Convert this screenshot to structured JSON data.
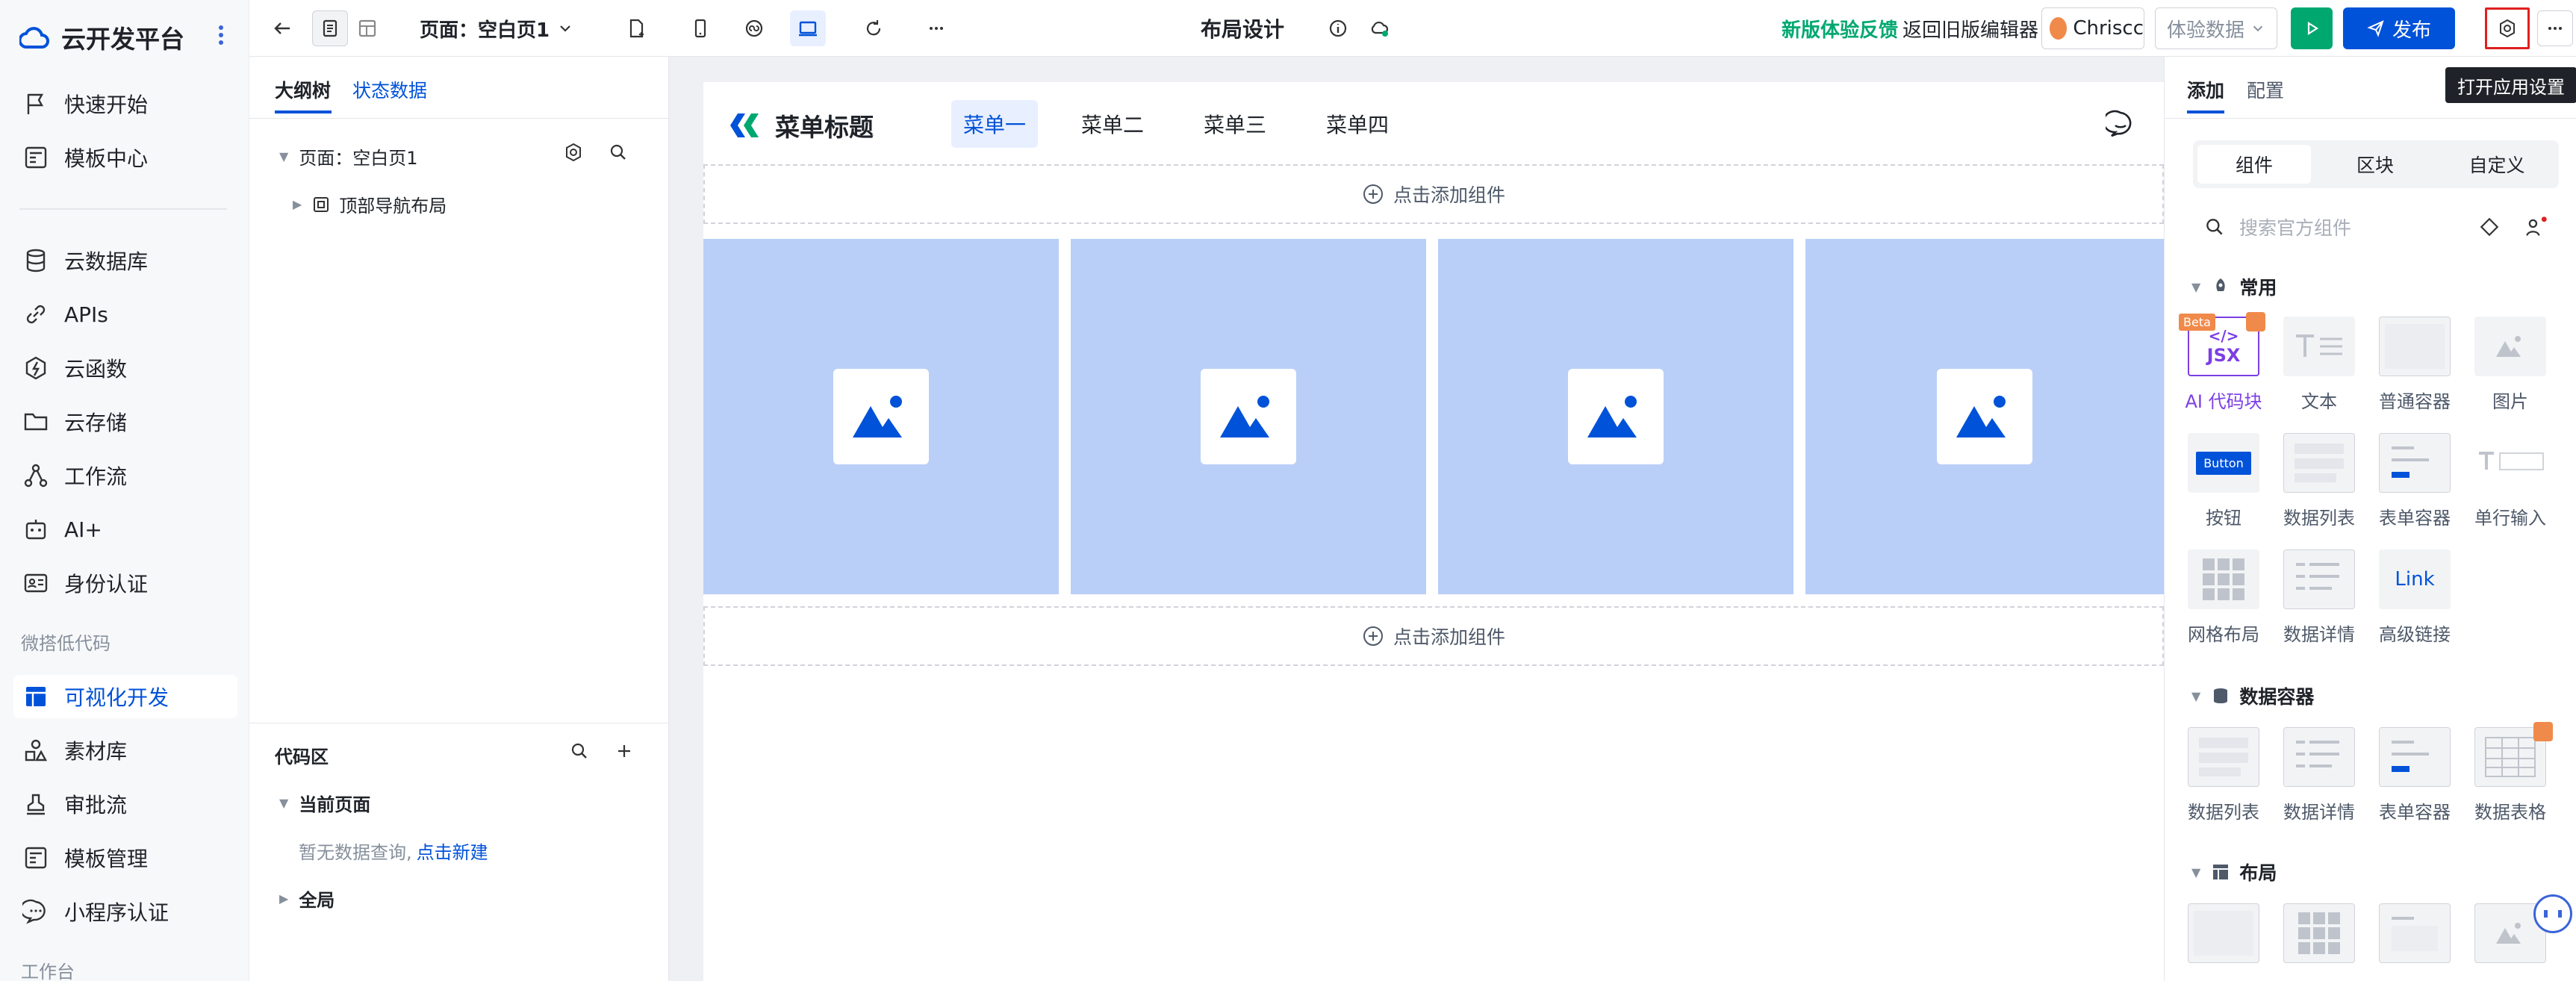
{
  "brand": {
    "name": "云开发平台"
  },
  "nav": {
    "items": [
      {
        "label": "快速开始",
        "icon": "flag-icon"
      },
      {
        "label": "模板中心",
        "icon": "template-icon"
      },
      {
        "label": "云数据库",
        "icon": "database-icon"
      },
      {
        "label": "APIs",
        "icon": "link-icon"
      },
      {
        "label": "云函数",
        "icon": "function-icon"
      },
      {
        "label": "云存储",
        "icon": "folder-icon"
      },
      {
        "label": "工作流",
        "icon": "workflow-icon"
      },
      {
        "label": "AI+",
        "icon": "robot-icon"
      },
      {
        "label": "身份认证",
        "icon": "id-card-icon"
      }
    ],
    "group_lowcode": "微搭低代码",
    "items2": [
      {
        "label": "可视化开发",
        "icon": "layout-icon",
        "active": true
      },
      {
        "label": "素材库",
        "icon": "shapes-icon"
      },
      {
        "label": "审批流",
        "icon": "stamp-icon"
      },
      {
        "label": "模板管理",
        "icon": "template-icon"
      },
      {
        "label": "小程序认证",
        "icon": "chat-icon"
      }
    ],
    "group_workbench": "工作台"
  },
  "topbar": {
    "page_select": "页面：空白页1",
    "title": "布局设计",
    "feedback": "新版体验反馈",
    "back_old": "返回旧版编辑器",
    "user": "Chriscc",
    "env_select": "体验数据",
    "publish": "发布",
    "tooltip": "打开应用设置"
  },
  "outline": {
    "tabs": [
      "大纲树",
      "状态数据"
    ],
    "page_node": "页面：空白页1",
    "child_node": "顶部导航布局",
    "code_title": "代码区",
    "current_page": "当前页面",
    "empty_text": "暂无数据查询,",
    "create_link": "点击新建",
    "global": "全局"
  },
  "canvas": {
    "menu_title": "菜单标题",
    "menus": [
      "菜单一",
      "菜单二",
      "菜单三",
      "菜单四"
    ],
    "add_component": "点击添加组件"
  },
  "right": {
    "tabs": [
      "添加",
      "配置"
    ],
    "segments": [
      "组件",
      "区块",
      "自定义"
    ],
    "search_placeholder": "搜索官方组件",
    "section_common": "常用",
    "common": [
      "AI 代码块",
      "文本",
      "普通容器",
      "图片",
      "按钮",
      "数据列表",
      "表单容器",
      "单行输入",
      "网格布局",
      "数据详情",
      "高级链接"
    ],
    "section_data": "数据容器",
    "data": [
      "数据列表",
      "数据详情",
      "表单容器",
      "数据表格"
    ],
    "section_layout": "布局",
    "beta": "Beta",
    "jsx": "JSX",
    "button_thumb": "Button",
    "link_thumb": "Link"
  },
  "colors": {
    "brand_blue": "#0052d9",
    "feedback_green": "#00a870",
    "run_green": "#00a870",
    "canvas_card": "#b9cff8"
  }
}
